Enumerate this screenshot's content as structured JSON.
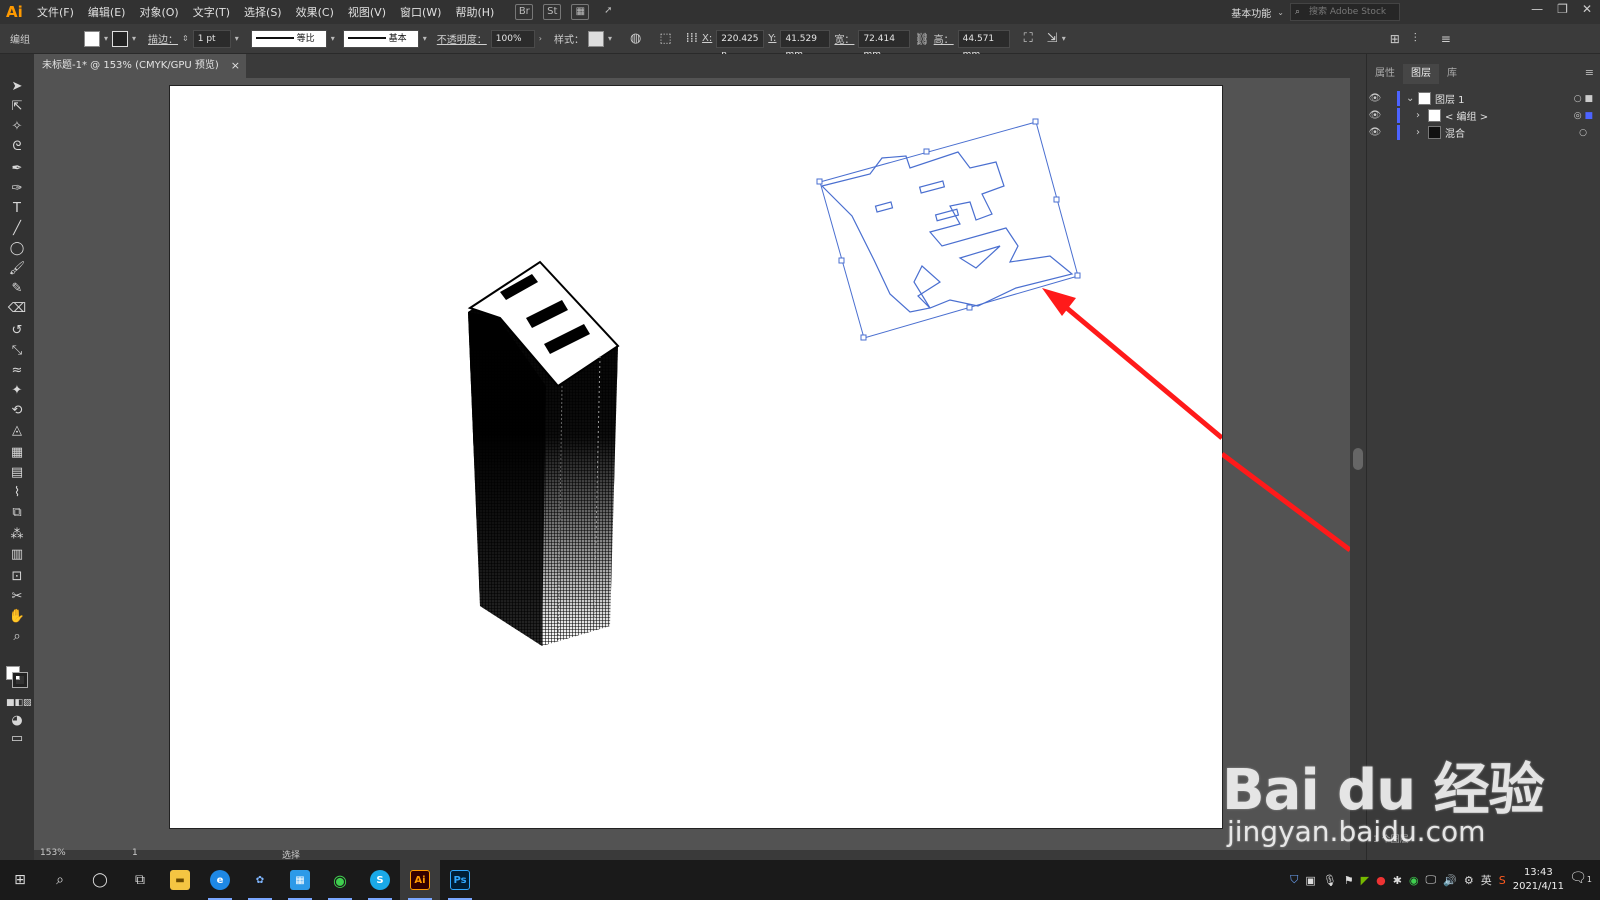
{
  "app": {
    "logo": "Ai"
  },
  "menus": [
    "文件(F)",
    "编辑(E)",
    "对象(O)",
    "文字(T)",
    "选择(S)",
    "效果(C)",
    "视图(V)",
    "窗口(W)",
    "帮助(H)"
  ],
  "menubar_icons": {
    "bridge": "Br",
    "stock": "St"
  },
  "workspace": {
    "label": "基本功能",
    "search_placeholder": "搜索 Adobe Stock"
  },
  "control": {
    "selection_type": "编组",
    "stroke_label": "描边：",
    "stroke_value": "1 pt",
    "profile_label": "等比",
    "brush_label": "基本",
    "opacity_label": "不透明度：",
    "opacity_value": "100%",
    "style_label": "样式：",
    "x_label": "X:",
    "x_value": "220.425 n",
    "y_label": "Y:",
    "y_value": "41.529 mm",
    "w_label": "宽：",
    "w_value": "72.414 mm",
    "h_label": "高：",
    "h_value": "44.571 mm"
  },
  "document": {
    "tab_title": "未标题-1* @ 153% (CMYK/GPU 预览)",
    "close": "×"
  },
  "status": {
    "zoom": "153%",
    "page": "1",
    "tool": "选择"
  },
  "panel": {
    "tabs": [
      "属性",
      "图层",
      "库"
    ],
    "active_tab": "图层",
    "layers": [
      {
        "name": "图层 1",
        "level": 0
      },
      {
        "name": "< 编组 >",
        "level": 1
      },
      {
        "name": "混合",
        "level": 1
      }
    ],
    "footer": "1 个图层"
  },
  "taskbar": {
    "time": "13:43",
    "date": "2021/4/11",
    "ime": "英",
    "ai_label": "Ai",
    "ps_label": "Ps",
    "notif_count": "1"
  },
  "watermark": {
    "brand": "Bai du 经验",
    "url": "jingyan.baidu.com"
  },
  "colors": {
    "accent_arrow": "#ff1a1a",
    "selection_blue": "#4a6fd0",
    "layer_lane": "#4c63ff",
    "ai_orange": "#ff9a00",
    "ps_blue": "#31a8ff"
  }
}
